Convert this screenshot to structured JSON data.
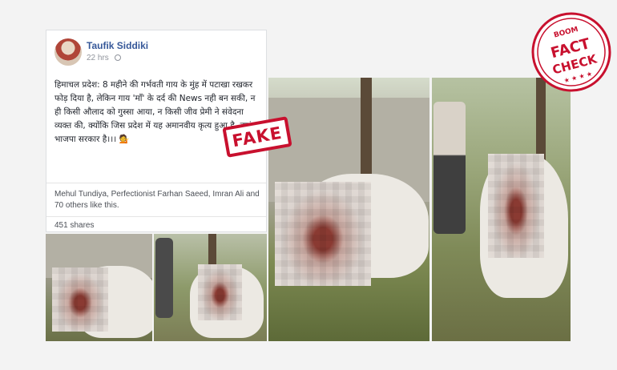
{
  "post": {
    "author": "Taufik Siddiki",
    "time": "22 hrs",
    "text": "हिमाचल प्रदेश: 8 महीने की गर्भवती गाय के मुंह में पटाखा रखकर फोड़ दिया है, लेकिन गाय 'माँ' के दर्द की News नही बन सकी, न ही किसी औलाद को गुस्सा आया, न किसी जीव प्रेमी ने संवेदना व्यक्त की, क्योंकि जिस प्रदेश में यह अमानवीय कृत्य हुआ है, वहां भाजपा सरकार है।।। 💁",
    "likes": "Mehul Tundiya, Perfectionist Farhan Saeed, Imran Ali and 70 others like this.",
    "shares": "451 shares"
  },
  "stamp": {
    "label": "FAKE",
    "color": "#c8102e"
  },
  "seal": {
    "top": "BOOM",
    "line1": "FACT",
    "line2": "CHECK",
    "color": "#c8102e"
  },
  "icons": [
    "globe-icon"
  ]
}
